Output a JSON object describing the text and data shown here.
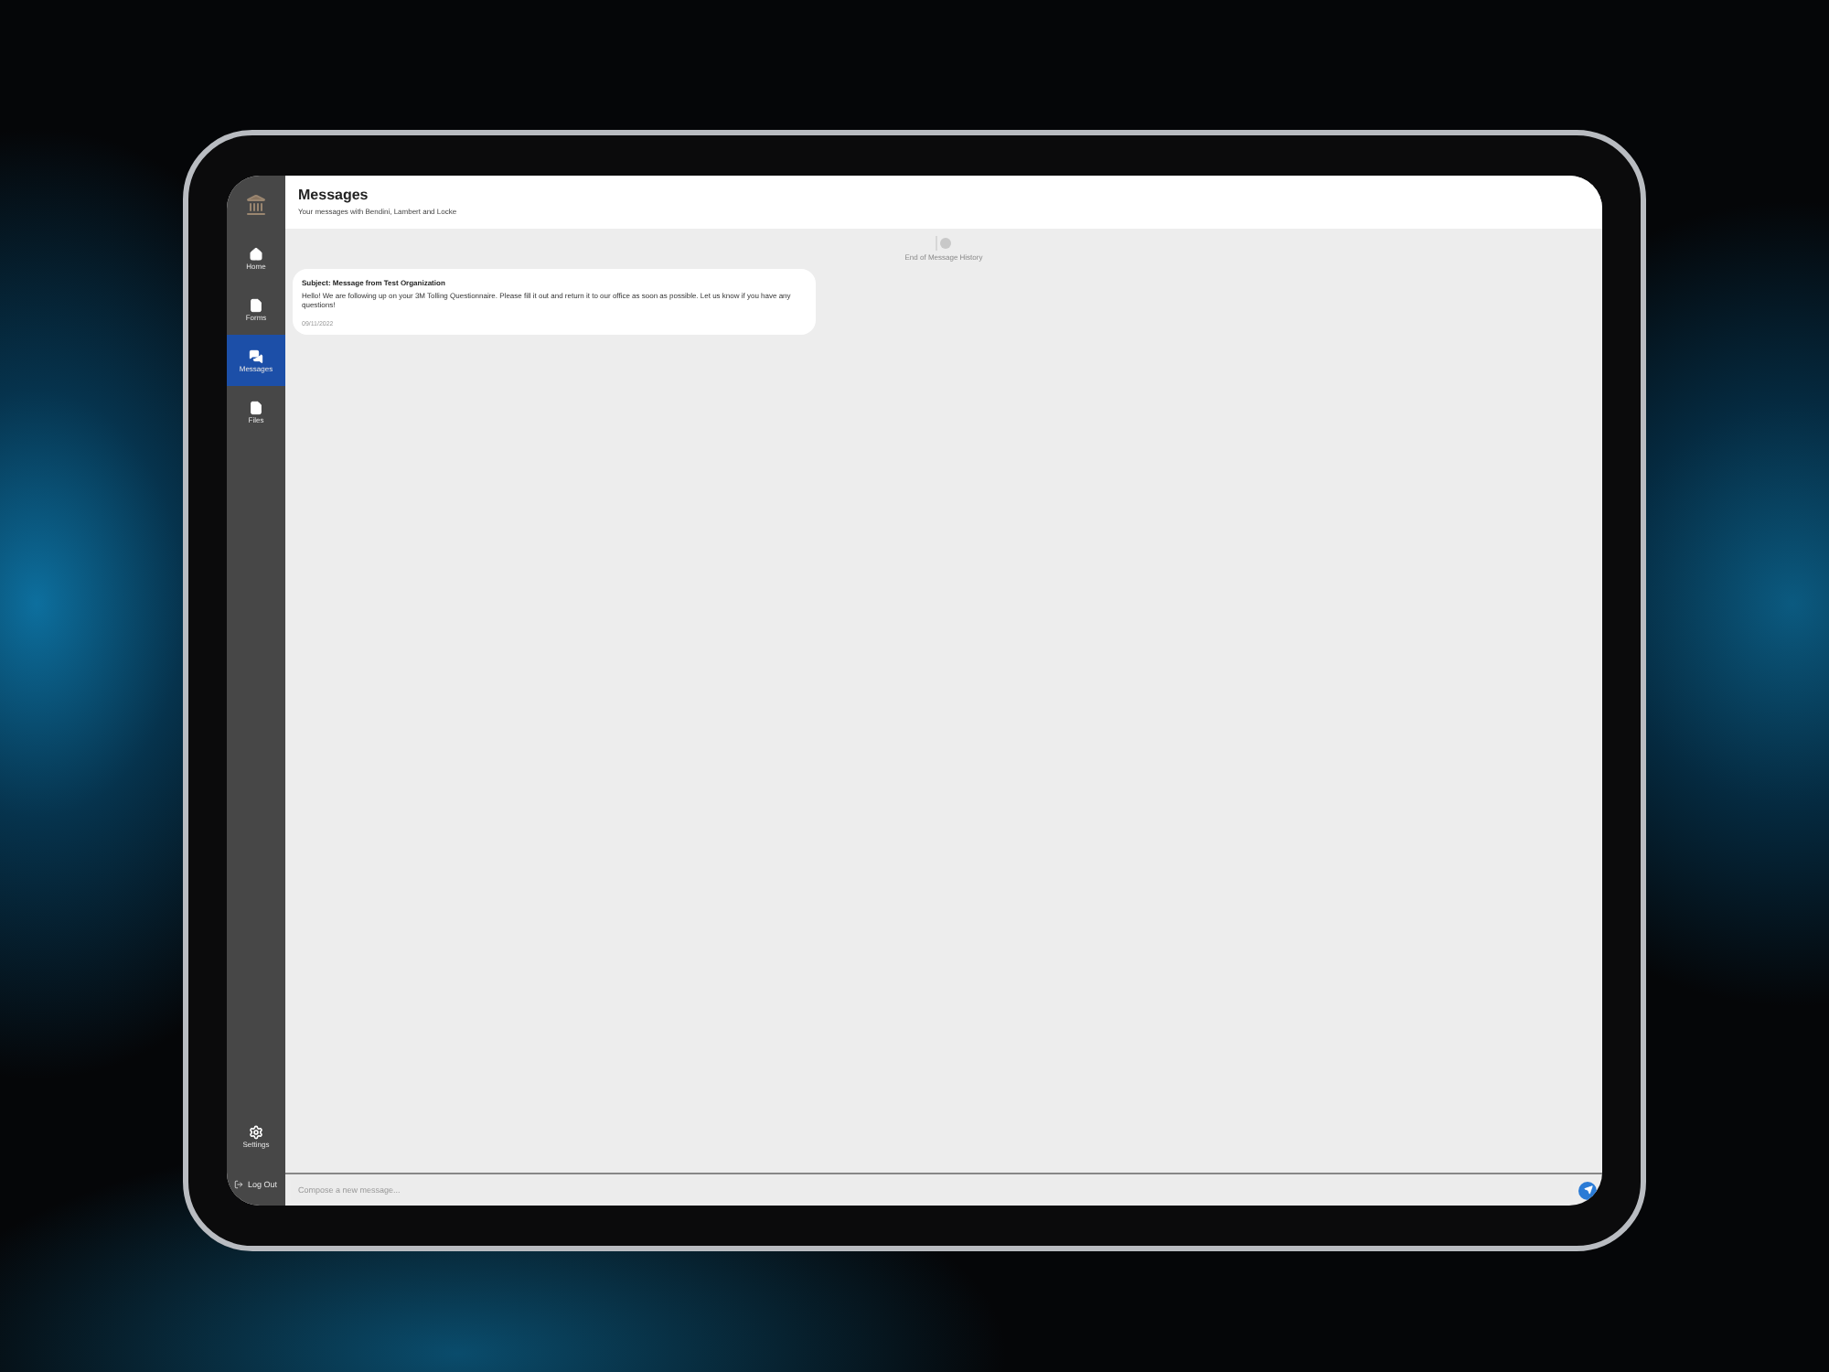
{
  "sidebar": {
    "items": [
      {
        "label": "Home",
        "selected": false
      },
      {
        "label": "Forms",
        "selected": false
      },
      {
        "label": "Messages",
        "selected": true
      },
      {
        "label": "Files",
        "selected": false
      }
    ],
    "settings": {
      "label": "Settings"
    },
    "logout": {
      "label": "Log Out"
    }
  },
  "header": {
    "title": "Messages",
    "subtitle": "Your messages with Bendini, Lambert and Locke"
  },
  "history_marker": "End of Message History",
  "messages": [
    {
      "subject": "Subject: Message from Test Organization",
      "body": "Hello! We are following up on your 3M Tolling Questionnaire. Please fill it out and return it to our office as soon as possible. Let us know if you have any questions!",
      "date": "09/11/2022"
    }
  ],
  "composer": {
    "placeholder": "Compose a new message..."
  }
}
